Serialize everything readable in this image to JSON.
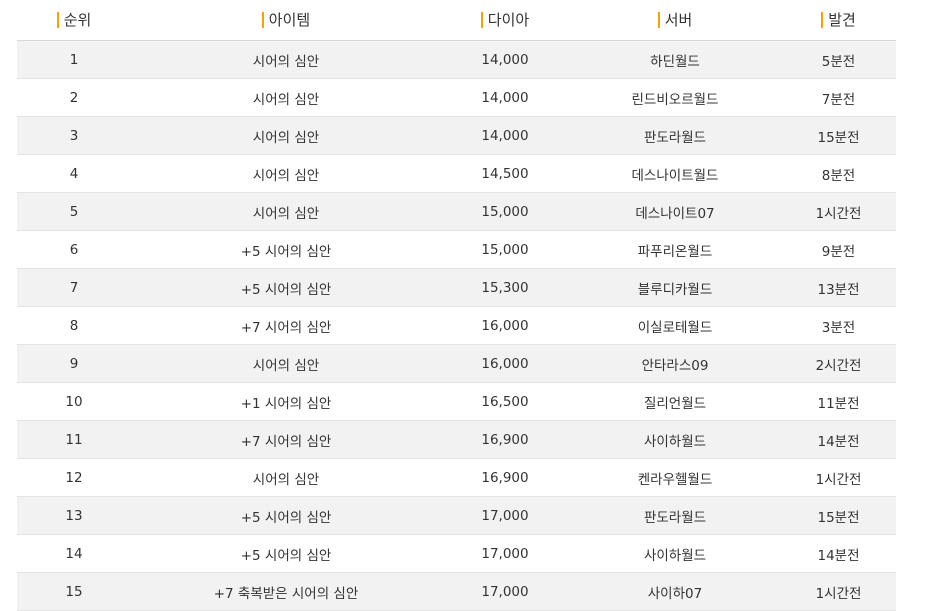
{
  "colors": {
    "accent": "#f0a500",
    "row_alt": "#f2f2f2",
    "border": "#e3e3e3",
    "text": "#333333"
  },
  "table": {
    "headers": {
      "rank": "순위",
      "item": "아이템",
      "diamond": "다이아",
      "server": "서버",
      "found": "발견"
    },
    "rows": [
      {
        "rank": "1",
        "item": "시어의 심안",
        "diamond": "14,000",
        "server": "하딘월드",
        "found": "5분전"
      },
      {
        "rank": "2",
        "item": "시어의 심안",
        "diamond": "14,000",
        "server": "린드비오르월드",
        "found": "7분전"
      },
      {
        "rank": "3",
        "item": "시어의 심안",
        "diamond": "14,000",
        "server": "판도라월드",
        "found": "15분전"
      },
      {
        "rank": "4",
        "item": "시어의 심안",
        "diamond": "14,500",
        "server": "데스나이트월드",
        "found": "8분전"
      },
      {
        "rank": "5",
        "item": "시어의 심안",
        "diamond": "15,000",
        "server": "데스나이트07",
        "found": "1시간전"
      },
      {
        "rank": "6",
        "item": "+5 시어의 심안",
        "diamond": "15,000",
        "server": "파푸리온월드",
        "found": "9분전"
      },
      {
        "rank": "7",
        "item": "+5 시어의 심안",
        "diamond": "15,300",
        "server": "블루디카월드",
        "found": "13분전"
      },
      {
        "rank": "8",
        "item": "+7 시어의 심안",
        "diamond": "16,000",
        "server": "이실로테월드",
        "found": "3분전"
      },
      {
        "rank": "9",
        "item": "시어의 심안",
        "diamond": "16,000",
        "server": "안타라스09",
        "found": "2시간전"
      },
      {
        "rank": "10",
        "item": "+1 시어의 심안",
        "diamond": "16,500",
        "server": "질리언월드",
        "found": "11분전"
      },
      {
        "rank": "11",
        "item": "+7 시어의 심안",
        "diamond": "16,900",
        "server": "사이하월드",
        "found": "14분전"
      },
      {
        "rank": "12",
        "item": "시어의 심안",
        "diamond": "16,900",
        "server": "켄라우헬월드",
        "found": "1시간전"
      },
      {
        "rank": "13",
        "item": "+5 시어의 심안",
        "diamond": "17,000",
        "server": "판도라월드",
        "found": "15분전"
      },
      {
        "rank": "14",
        "item": "+5 시어의 심안",
        "diamond": "17,000",
        "server": "사이하월드",
        "found": "14분전"
      },
      {
        "rank": "15",
        "item": "+7 축복받은 시어의 심안",
        "diamond": "17,000",
        "server": "사이하07",
        "found": "1시간전"
      }
    ]
  }
}
